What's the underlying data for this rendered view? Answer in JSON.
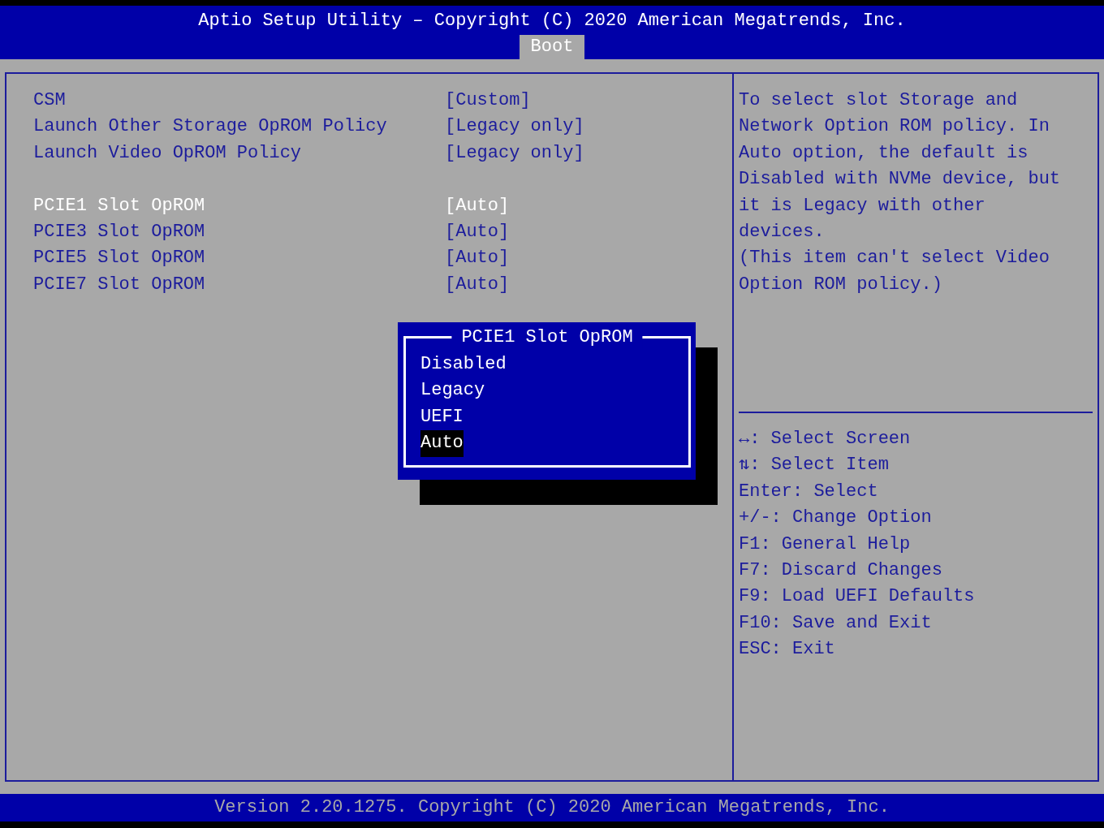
{
  "header": {
    "title": "Aptio Setup Utility – Copyright (C) 2020 American Megatrends, Inc.",
    "tabs": [
      {
        "label": "Boot",
        "selected": true
      }
    ]
  },
  "settings": {
    "groups": [
      [
        {
          "label": "CSM",
          "value": "[Custom]",
          "selected": false
        },
        {
          "label": "Launch Other Storage OpROM Policy",
          "value": "[Legacy only]",
          "selected": false
        },
        {
          "label": "Launch Video OpROM Policy",
          "value": "[Legacy only]",
          "selected": false
        }
      ],
      [
        {
          "label": "PCIE1 Slot OpROM",
          "value": "[Auto]",
          "selected": true
        },
        {
          "label": "PCIE3 Slot OpROM",
          "value": "[Auto]",
          "selected": false
        },
        {
          "label": "PCIE5 Slot OpROM",
          "value": "[Auto]",
          "selected": false
        },
        {
          "label": "PCIE7 Slot OpROM",
          "value": "[Auto]",
          "selected": false
        }
      ]
    ]
  },
  "popup": {
    "title": "PCIE1 Slot OpROM",
    "options": [
      {
        "label": "Disabled",
        "selected": false
      },
      {
        "label": "Legacy",
        "selected": false
      },
      {
        "label": "UEFI",
        "selected": false
      },
      {
        "label": "Auto",
        "selected": true
      }
    ]
  },
  "help": {
    "lines": [
      "To select slot Storage and",
      "Network Option ROM policy. In",
      "Auto option, the default is",
      "Disabled with NVMe device, but",
      "it is Legacy with other",
      "devices.",
      "(This item can't select Video",
      "Option ROM policy.)"
    ],
    "keys": [
      "↔: Select Screen",
      "⇅: Select Item",
      "Enter: Select",
      "+/-: Change Option",
      "F1: General Help",
      "F7: Discard Changes",
      "F9: Load UEFI Defaults",
      "F10: Save and Exit",
      "ESC: Exit"
    ]
  },
  "footer": "Version 2.20.1275. Copyright (C) 2020 American Megatrends, Inc."
}
